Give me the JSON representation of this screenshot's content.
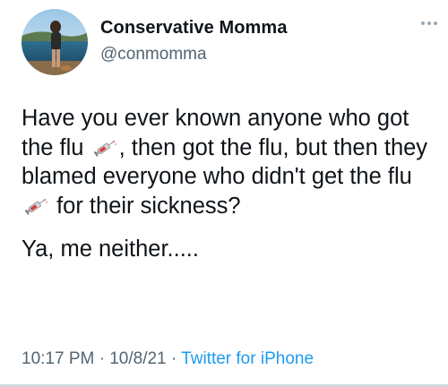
{
  "author": {
    "name": "Conservative Momma",
    "handle": "@conmomma"
  },
  "tweet": {
    "line_a": "Have you ever known anyone who got the flu",
    "line_b": ", then got the flu, but then they blamed everyone who didn't get the flu",
    "line_c": "for their sickness?",
    "line_d": "Ya, me neither.....",
    "emoji": "syringe-icon"
  },
  "meta": {
    "time": "10:17 PM",
    "sep1": "·",
    "date": "10/8/21",
    "sep2": "·",
    "source": "Twitter for iPhone"
  },
  "colors": {
    "text": "#0f1419",
    "secondary": "#536471",
    "link": "#1d9bf0"
  }
}
